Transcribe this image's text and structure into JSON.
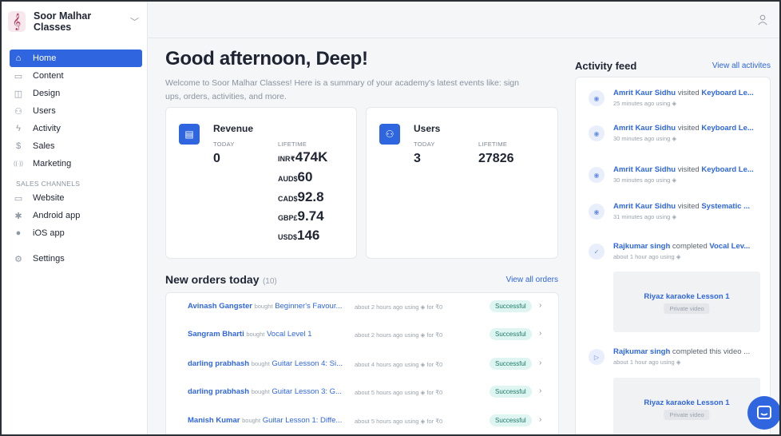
{
  "brand": {
    "name": "Soor Malhar Classes",
    "logo_glyph": "𝄞"
  },
  "sidebar": {
    "items": [
      {
        "label": "Home",
        "icon": "home-icon",
        "glyph": "⌂"
      },
      {
        "label": "Content",
        "icon": "book-icon",
        "glyph": "▭"
      },
      {
        "label": "Design",
        "icon": "layout-icon",
        "glyph": "◫"
      },
      {
        "label": "Users",
        "icon": "users-icon",
        "glyph": "⚇"
      },
      {
        "label": "Activity",
        "icon": "activity-icon",
        "glyph": "ϟ"
      },
      {
        "label": "Sales",
        "icon": "dollar-icon",
        "glyph": "$"
      },
      {
        "label": "Marketing",
        "icon": "broadcast-icon",
        "glyph": "((·))"
      }
    ],
    "sales_channels_label": "SALES CHANNELS",
    "channels": [
      {
        "label": "Website",
        "icon": "monitor-icon",
        "glyph": "▭"
      },
      {
        "label": "Android app",
        "icon": "android-icon",
        "glyph": "✱"
      },
      {
        "label": "iOS app",
        "icon": "apple-icon",
        "glyph": "●"
      }
    ],
    "settings": {
      "label": "Settings",
      "icon": "gear-icon",
      "glyph": "⚙"
    }
  },
  "main": {
    "greeting": "Good afternoon, Deep!",
    "subtext": "Welcome to Soor Malhar Classes! Here is a summary of your academy's latest events like: sign ups, orders, activities, and more."
  },
  "revenue": {
    "title": "Revenue",
    "today_label": "TODAY",
    "today_value": "0",
    "lifetime_label": "LIFETIME",
    "lifetime": [
      {
        "cur": "INR₹",
        "val": "474K"
      },
      {
        "cur": "AUD$",
        "val": "60"
      },
      {
        "cur": "CAD$",
        "val": "92.8"
      },
      {
        "cur": "GBP£",
        "val": "9.74"
      },
      {
        "cur": "USD$",
        "val": "146"
      }
    ]
  },
  "users": {
    "title": "Users",
    "today_label": "TODAY",
    "today_value": "3",
    "lifetime_label": "LIFETIME",
    "lifetime_value": "27826"
  },
  "orders": {
    "title": "New orders today",
    "count": "(10)",
    "view_all": "View all orders",
    "rows": [
      {
        "name": "Avinash Gangster",
        "verb": "bought",
        "item": "Beginner's Favour...",
        "meta": "about 2 hours ago using ◈ for ₹0",
        "status": "Successful"
      },
      {
        "name": "Sangram Bharti",
        "verb": "bought",
        "item": "Vocal Level 1",
        "meta": "about 2 hours ago using ◈ for ₹0",
        "status": "Successful"
      },
      {
        "name": "darling prabhash",
        "verb": "bought",
        "item": "Guitar Lesson 4: Si...",
        "meta": "about 4 hours ago using ◈ for ₹0",
        "status": "Successful"
      },
      {
        "name": "darling prabhash",
        "verb": "bought",
        "item": "Guitar Lesson 3: G...",
        "meta": "about 5 hours ago using ◈ for ₹0",
        "status": "Successful"
      },
      {
        "name": "Manish Kumar",
        "verb": "bought",
        "item": "Guitar Lesson 1: Diffe...",
        "meta": "about 5 hours ago using ◈ for ₹0",
        "status": "Successful"
      }
    ]
  },
  "activity": {
    "title": "Activity feed",
    "view_all": "View all activites",
    "items": [
      {
        "name": "Amrit Kaur Sidhu",
        "verb": "visited",
        "item": "Keyboard Le...",
        "time": "25 minutes ago using ◈",
        "icon": "eye-icon"
      },
      {
        "name": "Amrit Kaur Sidhu",
        "verb": "visited",
        "item": "Keyboard Le...",
        "time": "30 minutes ago using ◈",
        "icon": "eye-icon"
      },
      {
        "name": "Amrit Kaur Sidhu",
        "verb": "visited",
        "item": "Keyboard Le...",
        "time": "30 minutes ago using ◈",
        "icon": "eye-icon"
      },
      {
        "name": "Amrit Kaur Sidhu",
        "verb": "visited",
        "item": "Systematic ...",
        "time": "31 minutes ago using ◈",
        "icon": "eye-icon"
      },
      {
        "name": "Rajkumar singh",
        "verb": "completed",
        "item": "Vocal Lev...",
        "time": "about 1 hour ago using ◈",
        "icon": "check-icon"
      },
      {
        "name": "Rajkumar singh",
        "verb": "completed this video ...",
        "item": "",
        "time": "about 1 hour ago using ◈",
        "icon": "video-icon"
      }
    ],
    "videos": [
      {
        "title": "Riyaz karaoke Lesson 1",
        "badge": "Private video"
      },
      {
        "title": "Riyaz karaoke Lesson 1",
        "badge": "Private video"
      }
    ]
  }
}
